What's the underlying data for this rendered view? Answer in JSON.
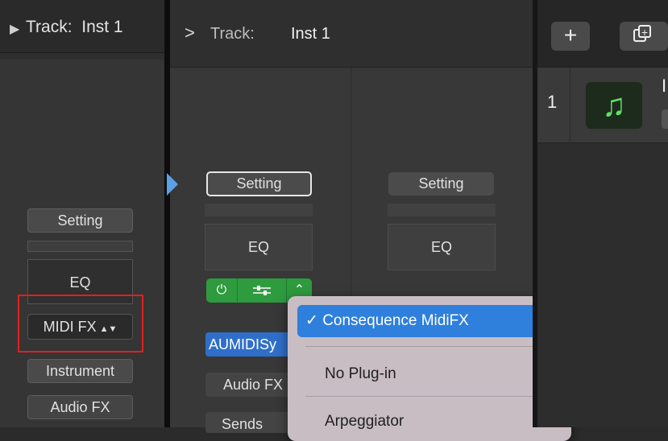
{
  "left_panel": {
    "track_label": "Track:",
    "track_name": "Inst 1",
    "setting": "Setting",
    "eq": "EQ",
    "midi_fx": "MIDI FX",
    "instrument": "Instrument",
    "audio_fx": "Audio FX"
  },
  "middle_panel": {
    "track_label": "Track:",
    "track_name": "Inst 1",
    "channel1": {
      "setting": "Setting",
      "eq": "EQ",
      "aumidi": "AUMIDISy",
      "audio_fx": "Audio FX",
      "sends": "Sends"
    },
    "channel2": {
      "setting": "Setting",
      "eq": "EQ"
    }
  },
  "popup_menu": {
    "selected": "✓ Consequence MidiFX",
    "items": [
      "No Plug-in",
      "Arpeggiator"
    ]
  },
  "tracks": {
    "add_label": "+",
    "rows": [
      {
        "number": "1",
        "name": "I"
      }
    ]
  },
  "colors": {
    "highlight": "#e02020",
    "menu_selected": "#2f7fdc",
    "plugin_green": "#2e9b3e",
    "aumidi_blue": "#2f6fc9"
  },
  "icons": {
    "plugin_power": "power-icon",
    "plugin_settings": "sliders-icon",
    "plugin_selector": "up-down-chevron-icon",
    "track_icon": "music-note-icon"
  }
}
